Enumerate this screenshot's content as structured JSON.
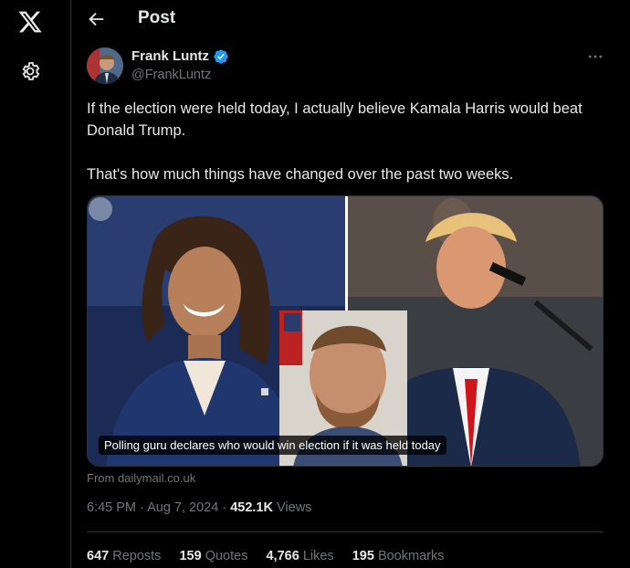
{
  "header": {
    "title": "Post"
  },
  "author": {
    "name": "Frank Luntz",
    "handle": "@FrankLuntz",
    "verified": true
  },
  "post": {
    "text": "If the election were held today, I actually believe Kamala Harris would beat Donald Trump.\n\nThat's how much things have changed over the past two weeks.",
    "card_caption": "Polling guru declares who would win election if it was held today",
    "card_source": "From dailymail.co.uk",
    "time": "6:45 PM",
    "date": "Aug 7, 2024",
    "views_count": "452.1K",
    "views_label": "Views"
  },
  "stats": {
    "reposts_count": "647",
    "reposts_label": "Reposts",
    "quotes_count": "159",
    "quotes_label": "Quotes",
    "likes_count": "4,766",
    "likes_label": "Likes",
    "bookmarks_count": "195",
    "bookmarks_label": "Bookmarks"
  },
  "icons": [
    "x-logo-icon",
    "settings-gear-icon",
    "back-arrow-icon",
    "verified-badge-icon",
    "more-options-icon"
  ],
  "colors": {
    "background": "#000000",
    "text": "#e7e9ea",
    "muted": "#71767b",
    "verified": "#1d9bf0",
    "border": "#2f3336"
  }
}
